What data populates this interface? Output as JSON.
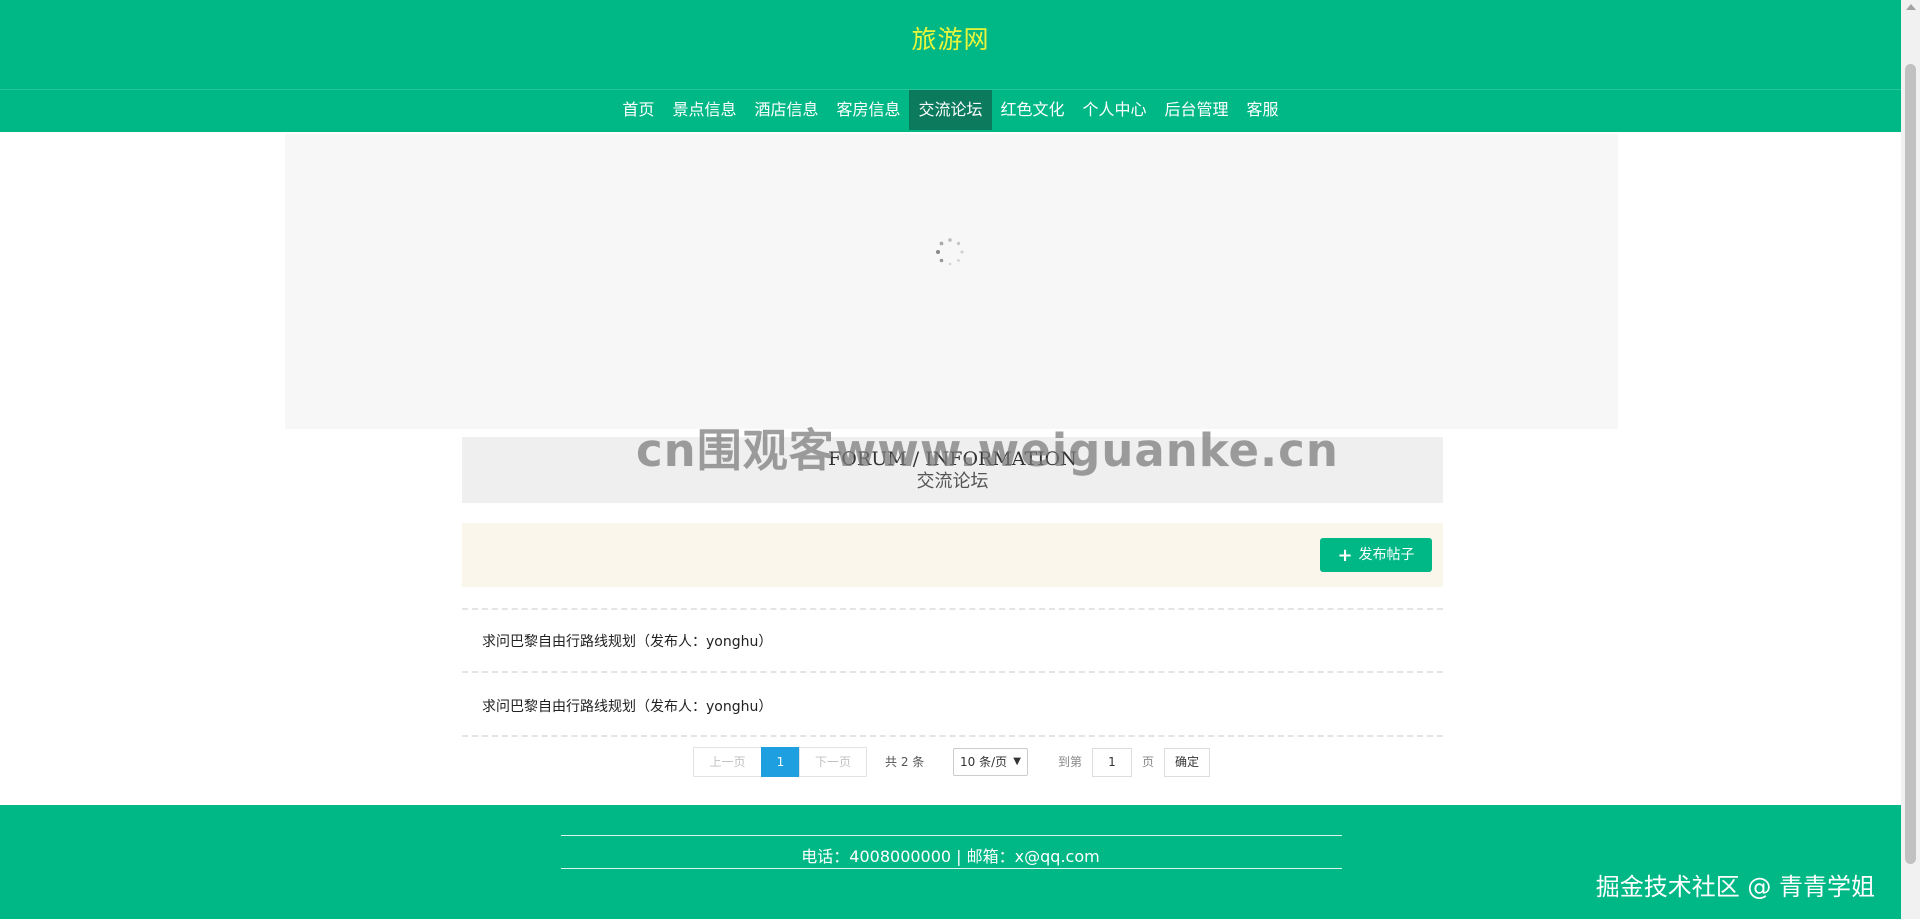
{
  "header": {
    "site_title": "旅游网",
    "nav": [
      {
        "label": "首页"
      },
      {
        "label": "景点信息"
      },
      {
        "label": "酒店信息"
      },
      {
        "label": "客房信息"
      },
      {
        "label": "交流论坛",
        "active": true
      },
      {
        "label": "红色文化"
      },
      {
        "label": "个人中心"
      },
      {
        "label": "后台管理"
      },
      {
        "label": "客服"
      }
    ]
  },
  "section": {
    "title_en": "FORUM / INFORMATION",
    "title_cn": "交流论坛"
  },
  "watermark": "cn围观客www.weiguanke.cn",
  "toolbar": {
    "publish_label": "发布帖子"
  },
  "posts": [
    {
      "text": "求问巴黎自由行路线规划（发布人：yonghu）"
    },
    {
      "text": "求问巴黎自由行路线规划（发布人：yonghu）"
    }
  ],
  "pagination": {
    "prev": "上一页",
    "current": "1",
    "next": "下一页",
    "total": "共 2 条",
    "page_size": "10 条/页",
    "goto_label": "到第",
    "goto_value": "1",
    "page_unit": "页",
    "confirm": "确定"
  },
  "footer": {
    "contact": "电话：4008000000 | 邮箱：x@qq.com",
    "corner_mark": "掘金技术社区 @ 青青学姐"
  },
  "colors": {
    "brand": "#00b886",
    "nav_active": "#0b7a5d",
    "title_yellow": "#e8f53a",
    "pager_active": "#1e9fe0",
    "toolbar_bg": "#fbf6ec"
  }
}
